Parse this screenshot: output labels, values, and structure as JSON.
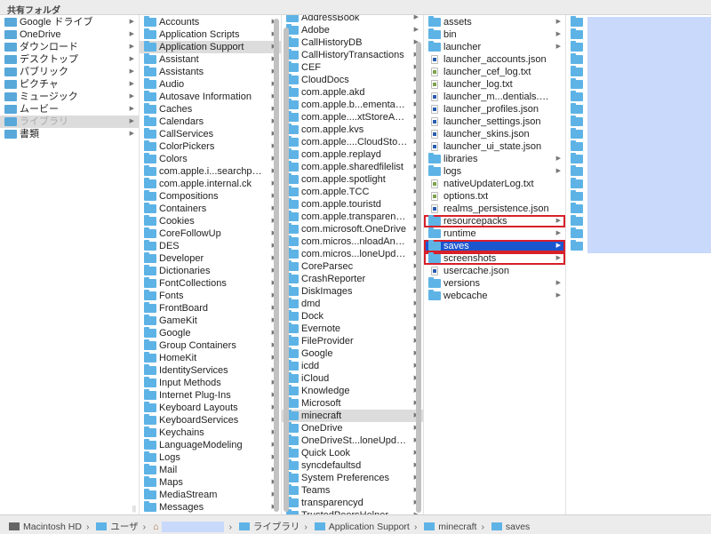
{
  "title": "共有フォルダ",
  "columns": [
    {
      "items": [
        {
          "name": "Google ドライブ",
          "type": "sys",
          "arrow": true
        },
        {
          "name": "OneDrive",
          "type": "sys",
          "arrow": true
        },
        {
          "name": "ダウンロード",
          "type": "sys",
          "arrow": true
        },
        {
          "name": "デスクトップ",
          "type": "sys",
          "arrow": true
        },
        {
          "name": "パブリック",
          "type": "sys",
          "arrow": true
        },
        {
          "name": "ピクチャ",
          "type": "sys",
          "arrow": true
        },
        {
          "name": "ミュージック",
          "type": "sys",
          "arrow": true
        },
        {
          "name": "ムービー",
          "type": "sys",
          "arrow": true
        },
        {
          "name": "ライブラリ",
          "type": "sys",
          "arrow": true,
          "state": "selected-dim"
        },
        {
          "name": "書類",
          "type": "sys",
          "arrow": true
        }
      ]
    },
    {
      "items": [
        {
          "name": "Accounts"
        },
        {
          "name": "Application Scripts"
        },
        {
          "name": "Application Support",
          "state": "selected"
        },
        {
          "name": "Assistant"
        },
        {
          "name": "Assistants"
        },
        {
          "name": "Audio"
        },
        {
          "name": "Autosave Information"
        },
        {
          "name": "Caches"
        },
        {
          "name": "Calendars"
        },
        {
          "name": "CallServices"
        },
        {
          "name": "ColorPickers"
        },
        {
          "name": "Colors"
        },
        {
          "name": "com.apple.i...searchpartyd"
        },
        {
          "name": "com.apple.internal.ck"
        },
        {
          "name": "Compositions"
        },
        {
          "name": "Containers"
        },
        {
          "name": "Cookies"
        },
        {
          "name": "CoreFollowUp"
        },
        {
          "name": "DES"
        },
        {
          "name": "Developer"
        },
        {
          "name": "Dictionaries"
        },
        {
          "name": "FontCollections"
        },
        {
          "name": "Fonts"
        },
        {
          "name": "FrontBoard"
        },
        {
          "name": "GameKit"
        },
        {
          "name": "Google"
        },
        {
          "name": "Group Containers"
        },
        {
          "name": "HomeKit"
        },
        {
          "name": "IdentityServices"
        },
        {
          "name": "Input Methods"
        },
        {
          "name": "Internet Plug-Ins"
        },
        {
          "name": "Keyboard Layouts"
        },
        {
          "name": "KeyboardServices"
        },
        {
          "name": "Keychains"
        },
        {
          "name": "LanguageModeling"
        },
        {
          "name": "Logs"
        },
        {
          "name": "Mail"
        },
        {
          "name": "Maps"
        },
        {
          "name": "MediaStream"
        },
        {
          "name": "Messages"
        }
      ]
    },
    {
      "items": [
        {
          "name": "AddressBook"
        },
        {
          "name": "Adobe"
        },
        {
          "name": "CallHistoryDB"
        },
        {
          "name": "CallHistoryTransactions"
        },
        {
          "name": "CEF"
        },
        {
          "name": "CloudDocs"
        },
        {
          "name": "com.apple.akd"
        },
        {
          "name": "com.apple.b...ementagent"
        },
        {
          "name": "com.apple....xtStoreAgent"
        },
        {
          "name": "com.apple.kvs"
        },
        {
          "name": "com.apple....CloudStorage"
        },
        {
          "name": "com.apple.replayd"
        },
        {
          "name": "com.apple.sharedfilelist"
        },
        {
          "name": "com.apple.spotlight"
        },
        {
          "name": "com.apple.TCC"
        },
        {
          "name": "com.apple.touristd"
        },
        {
          "name": "com.apple.transparencyd"
        },
        {
          "name": "com.microsoft.OneDrive"
        },
        {
          "name": "com.micros...nloadAndGo"
        },
        {
          "name": "com.micros...loneUpdater"
        },
        {
          "name": "CoreParsec"
        },
        {
          "name": "CrashReporter"
        },
        {
          "name": "DiskImages"
        },
        {
          "name": "dmd"
        },
        {
          "name": "Dock"
        },
        {
          "name": "Evernote"
        },
        {
          "name": "FileProvider"
        },
        {
          "name": "Google"
        },
        {
          "name": "icdd"
        },
        {
          "name": "iCloud"
        },
        {
          "name": "Knowledge"
        },
        {
          "name": "Microsoft"
        },
        {
          "name": "minecraft",
          "state": "selected"
        },
        {
          "name": "OneDrive"
        },
        {
          "name": "OneDriveSt...loneUpdater"
        },
        {
          "name": "Quick Look"
        },
        {
          "name": "syncdefaultsd"
        },
        {
          "name": "System Preferences"
        },
        {
          "name": "Teams"
        },
        {
          "name": "transparencyd"
        },
        {
          "name": "TrustedPeersHelper"
        }
      ]
    },
    {
      "items": [
        {
          "name": "assets"
        },
        {
          "name": "bin"
        },
        {
          "name": "launcher"
        },
        {
          "name": "launcher_accounts.json",
          "type": "json"
        },
        {
          "name": "launcher_cef_log.txt",
          "type": "txt"
        },
        {
          "name": "launcher_log.txt",
          "type": "txt"
        },
        {
          "name": "launcher_m...dentials.json",
          "type": "json"
        },
        {
          "name": "launcher_profiles.json",
          "type": "json"
        },
        {
          "name": "launcher_settings.json",
          "type": "json"
        },
        {
          "name": "launcher_skins.json",
          "type": "json"
        },
        {
          "name": "launcher_ui_state.json",
          "type": "json"
        },
        {
          "name": "libraries"
        },
        {
          "name": "logs"
        },
        {
          "name": "nativeUpdaterLog.txt",
          "type": "txt"
        },
        {
          "name": "options.txt",
          "type": "txt"
        },
        {
          "name": "realms_persistence.json",
          "type": "json"
        },
        {
          "name": "resourcepacks",
          "highlight": true
        },
        {
          "name": "runtime"
        },
        {
          "name": "saves",
          "state": "active",
          "highlight": true
        },
        {
          "name": "screenshots",
          "highlight": true
        },
        {
          "name": "usercache.json",
          "type": "json"
        },
        {
          "name": "versions"
        },
        {
          "name": "webcache"
        }
      ]
    },
    {
      "items": [
        {},
        {},
        {},
        {},
        {},
        {},
        {},
        {},
        {},
        {},
        {},
        {},
        {},
        {},
        {},
        {},
        {},
        {},
        {}
      ]
    }
  ],
  "path": {
    "root": "Macintosh HD",
    "segments": [
      "ユーザ",
      "",
      "ライブラリ",
      "Application Support",
      "minecraft",
      "saves"
    ]
  },
  "colors": {
    "selection": "#1c56cf",
    "highlight_box": "#d8202a",
    "redaction": "#c9d9fb"
  }
}
